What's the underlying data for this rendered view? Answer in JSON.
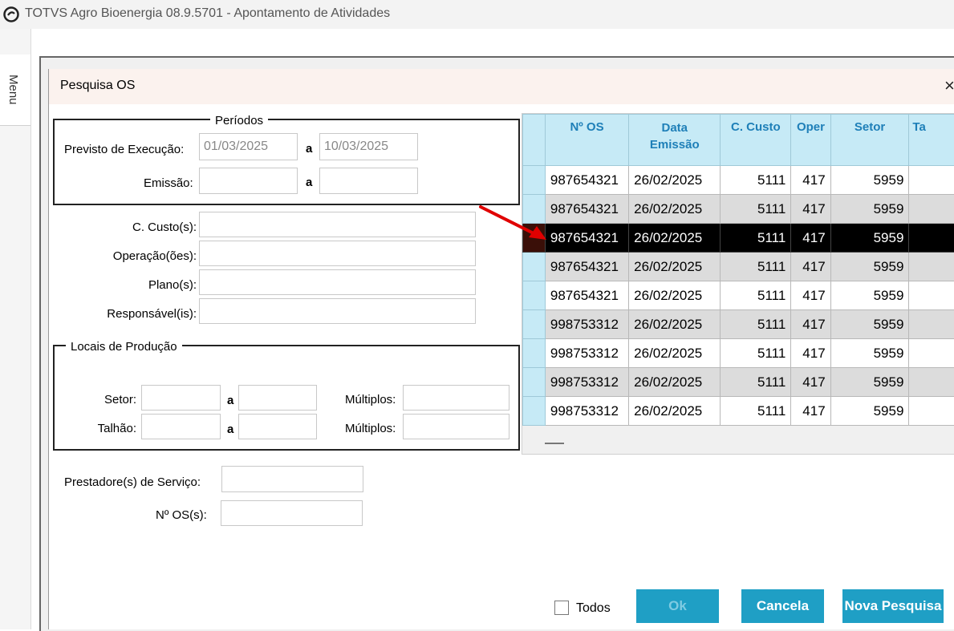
{
  "window": {
    "title": "TOTVS Agro Bioenergia 08.9.5701 - Apontamento de Atividades"
  },
  "sidebar": {
    "menu_label": "Menu"
  },
  "dialog": {
    "title": "Pesquisa OS",
    "close_glyph": "×",
    "periodos": {
      "legend": "Períodos",
      "previsto_label": "Previsto de Execução:",
      "previsto_from": "01/03/2025",
      "previsto_to": "10/03/2025",
      "emissao_label": "Emissão:",
      "emissao_from": "",
      "emissao_to": "",
      "a": "a"
    },
    "filters": {
      "ccusto_label": "C. Custo(s):",
      "operacao_label": "Operação(ões):",
      "plano_label": "Plano(s):",
      "responsavel_label": "Responsável(is):"
    },
    "locais": {
      "legend": "Locais de Produção",
      "setor_label": "Setor:",
      "talhao_label": "Talhão:",
      "a": "a",
      "multiplos_label": "Múltiplos:"
    },
    "prestador_label": "Prestadore(s) de Serviço:",
    "nos_label": "Nº OS(s):",
    "grid": {
      "columns": [
        "Nº OS",
        "Data\nEmissão",
        "C. Custo",
        "Oper",
        "Setor",
        "Ta"
      ],
      "rows": [
        [
          "987654321",
          "26/02/2025",
          "5111",
          "417",
          "5959"
        ],
        [
          "987654321",
          "26/02/2025",
          "5111",
          "417",
          "5959"
        ],
        [
          "987654321",
          "26/02/2025",
          "5111",
          "417",
          "5959"
        ],
        [
          "987654321",
          "26/02/2025",
          "5111",
          "417",
          "5959"
        ],
        [
          "987654321",
          "26/02/2025",
          "5111",
          "417",
          "5959"
        ],
        [
          "998753312",
          "26/02/2025",
          "5111",
          "417",
          "5959"
        ],
        [
          "998753312",
          "26/02/2025",
          "5111",
          "417",
          "5959"
        ],
        [
          "998753312",
          "26/02/2025",
          "5111",
          "417",
          "5959"
        ],
        [
          "998753312",
          "26/02/2025",
          "5111",
          "417",
          "5959"
        ]
      ],
      "selected_row": 2
    },
    "todos_label": "Todos",
    "buttons": {
      "ok": "Ok",
      "cancela": "Cancela",
      "nova_pesquisa": "Nova Pesquisa"
    }
  },
  "colors": {
    "accent": "#1f9fc5",
    "grid_header": "#c6eaf6",
    "arrow": "#e00000"
  },
  "icons": {
    "app_logo": "totvs-logo-icon",
    "close": "close-icon",
    "pointer": "red-arrow-icon"
  }
}
